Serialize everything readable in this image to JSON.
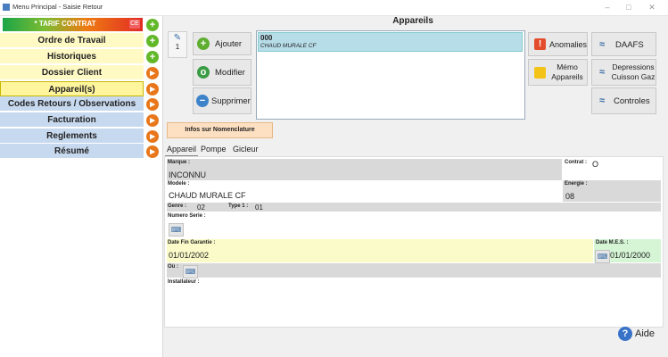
{
  "window": {
    "title": "Menu Principal - Saisie Retour",
    "minimize": "–",
    "maximize": "□",
    "close": "✕"
  },
  "sidebar": {
    "contract_label": "* TARIF CONTRAT",
    "contract_close": "CE",
    "items": [
      {
        "label": "Ordre de Travail",
        "icon": "plus-icon"
      },
      {
        "label": "Historiques",
        "icon": "plus-icon"
      },
      {
        "label": "Dossier Client",
        "icon": "arrow-icon"
      },
      {
        "label": "Appareil(s)",
        "icon": "arrow-icon"
      },
      {
        "label": "Codes Retours / Observations",
        "icon": "arrow-icon"
      },
      {
        "label": "Facturation",
        "icon": "arrow-icon"
      },
      {
        "label": "Reglements",
        "icon": "arrow-icon"
      },
      {
        "label": "Résumé",
        "icon": "arrow-icon"
      }
    ],
    "icon_glyphs": {
      "plus": "+",
      "arrow": "▸"
    }
  },
  "main": {
    "title": "Appareils",
    "count": "1",
    "buttons": {
      "add": "Ajouter",
      "modify": "Modifier",
      "delete": "Supprimer"
    },
    "list": [
      {
        "code": "000",
        "name": "CHAUD MURALE CF"
      }
    ],
    "right_buttons": {
      "anomalies": "Anomalies",
      "memo": "Mémo Appareils",
      "daafs": "DAAFS",
      "depressions": "Depressions Cuisson Gaz",
      "controles": "Controles"
    },
    "nomenclature": "Infos sur Nomenclature",
    "tabs": [
      "Appareil",
      "Pompe",
      "Gicleur"
    ]
  },
  "form": {
    "marque_label": "Marque :",
    "marque_value": "INCONNU",
    "contrat_label": "Contrat :",
    "contrat_value": "O",
    "modele_label": "Modele :",
    "modele_value": "CHAUD MURALE CF",
    "energie_label": "Energie :",
    "energie_value": "08",
    "genre_label": "Genre :",
    "genre_value": "02",
    "type_label": "Type 1 :",
    "type_value": "01",
    "serie_label": "Numero Serie :",
    "garantie_label": "Date Fin Garantie :",
    "garantie_value": "01/01/2002",
    "mes_label": "Date M.E.S. :",
    "mes_value": "01/01/2000",
    "ou_label": "Où :",
    "installateur_label": "Installateur :"
  },
  "help_label": "Aide"
}
